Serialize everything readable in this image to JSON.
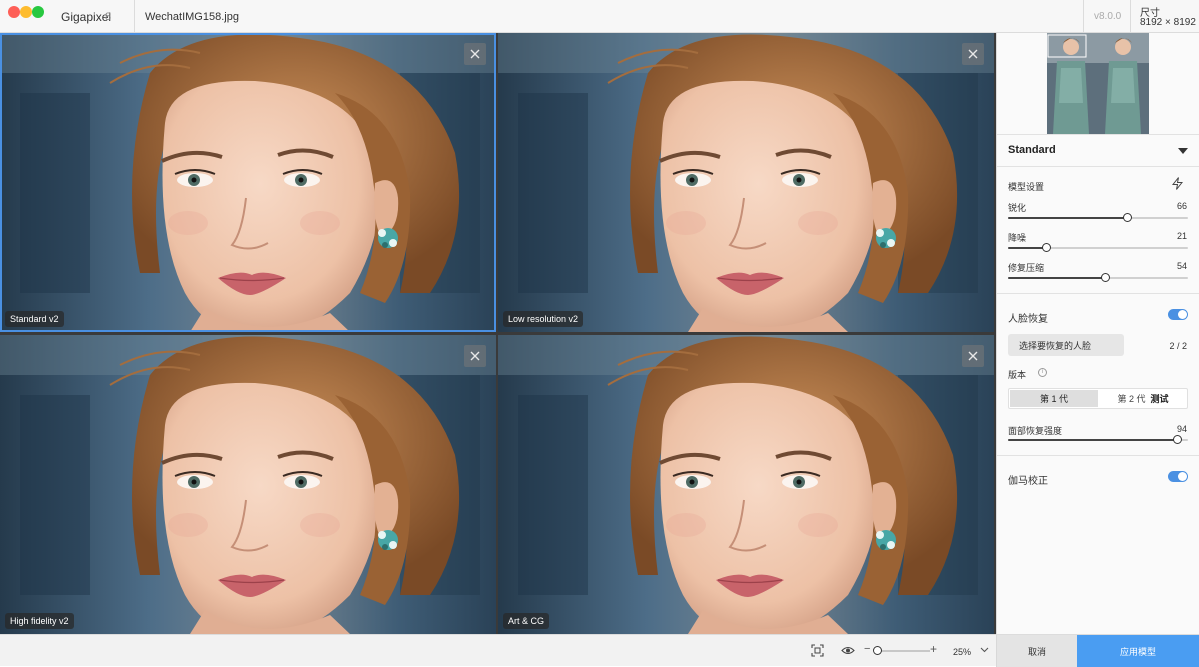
{
  "window": {
    "app_name": "Gigapixel",
    "app_version": "8",
    "file_name": "WechatIMG158.jpg",
    "release": "v8.0.0",
    "size_label": "尺寸",
    "size_value": "8192 × 8192"
  },
  "previews": [
    {
      "label": "Standard v2",
      "selected": true
    },
    {
      "label": "Low resolution v2",
      "selected": false
    },
    {
      "label": "High fidelity v2",
      "selected": false
    },
    {
      "label": "Art & CG",
      "selected": false
    }
  ],
  "sidebar": {
    "model": "Standard",
    "model_settings_title": "模型设置",
    "sliders": [
      {
        "label": "锐化",
        "value": 66
      },
      {
        "label": "降噪",
        "value": 21
      },
      {
        "label": "修复压缩",
        "value": 54
      }
    ],
    "face_recovery": {
      "title": "人脸恢复",
      "enabled": true,
      "select_button": "选择要恢复的人脸",
      "count": "2 / 2",
      "version_label": "版本",
      "version_options": [
        "第 1 代",
        "第 2 代"
      ],
      "beta_label": "测试",
      "selected_version": "第 1 代",
      "strength_label": "面部恢复强度",
      "strength_value": 94
    },
    "gamma": {
      "title": "伽马校正",
      "enabled": true
    }
  },
  "bottom": {
    "zoom": "25%",
    "zoom_level": 0,
    "cancel": "取消",
    "apply": "应用模型"
  }
}
